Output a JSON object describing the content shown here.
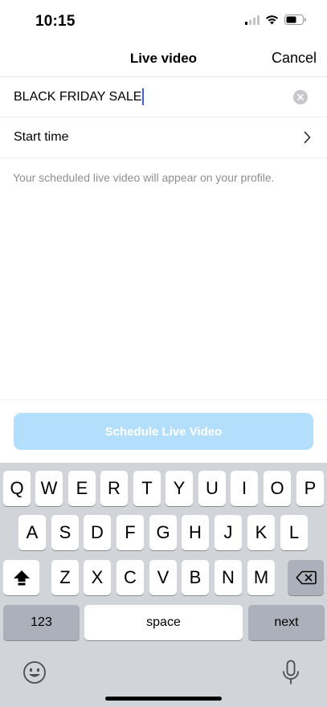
{
  "status_bar": {
    "time": "10:15"
  },
  "nav": {
    "title": "Live video",
    "cancel_label": "Cancel"
  },
  "form": {
    "title_value": "BLACK FRIDAY SALE",
    "start_time_label": "Start time",
    "info_text": "Your scheduled live video will appear on your profile."
  },
  "actions": {
    "schedule_label": "Schedule Live Video"
  },
  "keyboard": {
    "row1": [
      "Q",
      "W",
      "E",
      "R",
      "T",
      "Y",
      "U",
      "I",
      "O",
      "P"
    ],
    "row2": [
      "A",
      "S",
      "D",
      "F",
      "G",
      "H",
      "J",
      "K",
      "L"
    ],
    "row3": [
      "Z",
      "X",
      "C",
      "V",
      "B",
      "N",
      "M"
    ],
    "numbers_label": "123",
    "space_label": "space",
    "next_label": "next"
  },
  "colors": {
    "accent_disabled": "#b3dffc",
    "cursor": "#3c5ef0",
    "keyboard_bg": "#d1d4d9"
  }
}
